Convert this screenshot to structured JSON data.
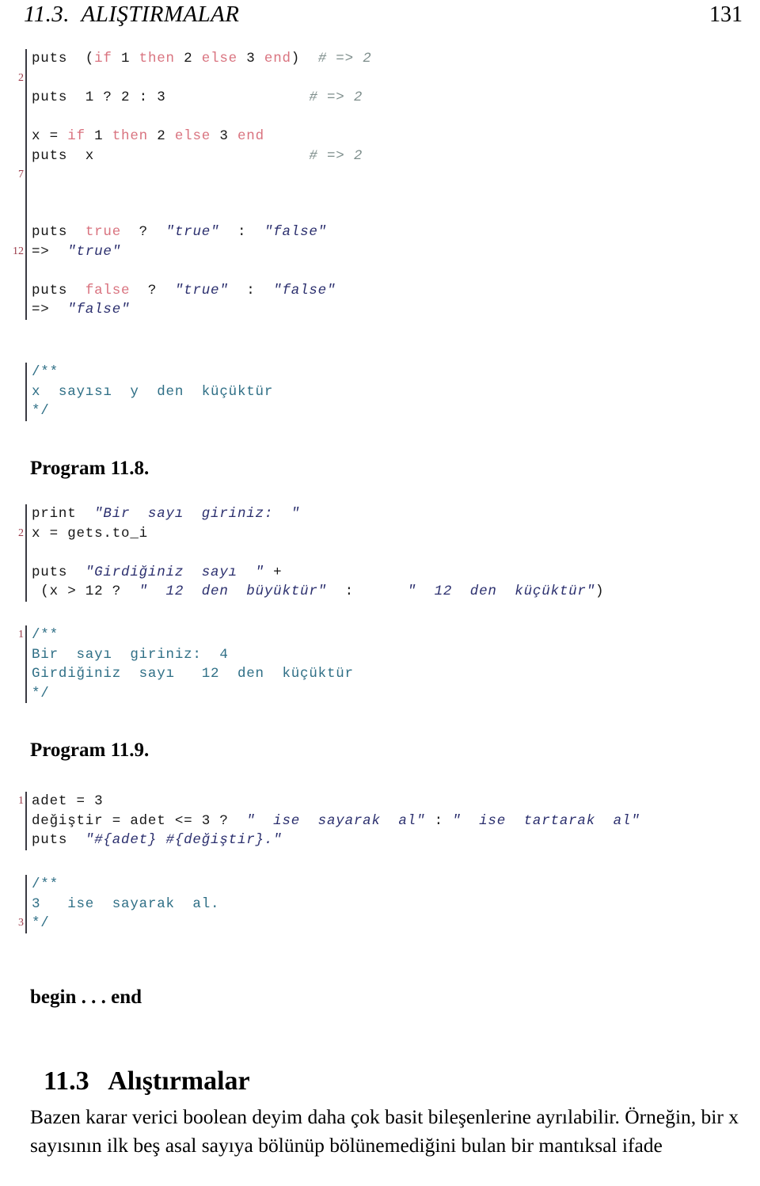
{
  "header": {
    "title": "11.3.  ALIŞTIRMALAR",
    "page_number": "131"
  },
  "listings": [
    {
      "name": "listing-ternary-if",
      "gutter": [
        {
          "num": "2",
          "line_index": 1
        },
        {
          "num": "7",
          "line_index": 6
        }
      ],
      "lines": [
        {
          "segments": [
            {
              "cls": "t-plain",
              "text": "puts  ("
            },
            {
              "cls": "t-kw",
              "text": "if"
            },
            {
              "cls": "t-plain",
              "text": " 1 "
            },
            {
              "cls": "t-kw",
              "text": "then"
            },
            {
              "cls": "t-plain",
              "text": " 2 "
            },
            {
              "cls": "t-kw",
              "text": "else"
            },
            {
              "cls": "t-plain",
              "text": " 3 "
            },
            {
              "cls": "t-kw",
              "text": "end"
            },
            {
              "cls": "t-plain",
              "text": ")  "
            },
            {
              "cls": "t-cmt",
              "text": "# => 2"
            }
          ]
        },
        {
          "segments": []
        },
        {
          "segments": [
            {
              "cls": "t-plain",
              "text": "puts  1 ? 2 : 3                "
            },
            {
              "cls": "t-cmt",
              "text": "# => 2"
            }
          ]
        },
        {
          "segments": []
        },
        {
          "segments": [
            {
              "cls": "t-plain",
              "text": "x = "
            },
            {
              "cls": "t-kw",
              "text": "if"
            },
            {
              "cls": "t-plain",
              "text": " 1 "
            },
            {
              "cls": "t-kw",
              "text": "then"
            },
            {
              "cls": "t-plain",
              "text": " 2 "
            },
            {
              "cls": "t-kw",
              "text": "else"
            },
            {
              "cls": "t-plain",
              "text": " 3 "
            },
            {
              "cls": "t-kw",
              "text": "end"
            }
          ]
        },
        {
          "segments": [
            {
              "cls": "t-plain",
              "text": "puts  x                        "
            },
            {
              "cls": "t-cmt",
              "text": "# => 2"
            }
          ]
        },
        {
          "segments": []
        },
        {
          "segments": []
        },
        {
          "segments": []
        }
      ]
    },
    {
      "name": "listing-true-false",
      "gutter": [
        {
          "num": "12",
          "line_index": 1
        }
      ],
      "lines": [
        {
          "segments": [
            {
              "cls": "t-plain",
              "text": "puts  "
            },
            {
              "cls": "t-kw",
              "text": "true"
            },
            {
              "cls": "t-plain",
              "text": "  ?  "
            },
            {
              "cls": "t-str",
              "text": "\"true\""
            },
            {
              "cls": "t-plain",
              "text": "  :  "
            },
            {
              "cls": "t-str",
              "text": "\"false\""
            }
          ]
        },
        {
          "segments": [
            {
              "cls": "t-plain",
              "text": "=>  "
            },
            {
              "cls": "t-str",
              "text": "\"true\""
            }
          ]
        },
        {
          "segments": []
        },
        {
          "segments": [
            {
              "cls": "t-plain",
              "text": "puts  "
            },
            {
              "cls": "t-kw",
              "text": "false"
            },
            {
              "cls": "t-plain",
              "text": "  ?  "
            },
            {
              "cls": "t-str",
              "text": "\"true\""
            },
            {
              "cls": "t-plain",
              "text": "  :  "
            },
            {
              "cls": "t-str",
              "text": "\"false\""
            }
          ]
        },
        {
          "segments": [
            {
              "cls": "t-plain",
              "text": "=>  "
            },
            {
              "cls": "t-str",
              "text": "\"false\""
            }
          ]
        }
      ]
    },
    {
      "name": "listing-doc-x-kucuktur",
      "gutter": [],
      "lines": [
        {
          "segments": [
            {
              "cls": "t-doc",
              "text": "/**"
            }
          ]
        },
        {
          "segments": [
            {
              "cls": "t-doc",
              "text": "x  sayısı  y  den  küçüktür"
            }
          ]
        },
        {
          "segments": [
            {
              "cls": "t-doc",
              "text": "*/"
            }
          ]
        }
      ]
    },
    {
      "name": "listing-program-11-8-code",
      "gutter": [
        {
          "num": "2",
          "line_index": 1
        }
      ],
      "lines": [
        {
          "segments": [
            {
              "cls": "t-plain",
              "text": "print  "
            },
            {
              "cls": "t-str",
              "text": "\"Bir  sayı  giriniz:  \""
            }
          ]
        },
        {
          "segments": [
            {
              "cls": "t-plain",
              "text": "x = gets.to_i"
            }
          ]
        },
        {
          "segments": []
        },
        {
          "segments": [
            {
              "cls": "t-plain",
              "text": "puts  "
            },
            {
              "cls": "t-str",
              "text": "\"Girdiğiniz  sayı  \""
            },
            {
              "cls": "t-plain",
              "text": " +"
            }
          ]
        },
        {
          "segments": [
            {
              "cls": "t-plain",
              "text": " (x > 12 ?  "
            },
            {
              "cls": "t-str",
              "text": "\"  12  den  büyüktür\""
            },
            {
              "cls": "t-plain",
              "text": "  :      "
            },
            {
              "cls": "t-str",
              "text": "\"  12  den  küçüktür\""
            },
            {
              "cls": "t-plain",
              "text": ")"
            }
          ]
        }
      ]
    },
    {
      "name": "listing-program-11-8-output",
      "gutter": [
        {
          "num": "1",
          "line_index": 0
        }
      ],
      "lines": [
        {
          "segments": [
            {
              "cls": "t-doc",
              "text": "/**"
            }
          ]
        },
        {
          "segments": [
            {
              "cls": "t-doc",
              "text": "Bir  sayı  giriniz:  4"
            }
          ]
        },
        {
          "segments": [
            {
              "cls": "t-doc",
              "text": "Girdiğiniz  sayı   12  den  küçüktür"
            }
          ]
        },
        {
          "segments": [
            {
              "cls": "t-doc",
              "text": "*/"
            }
          ]
        }
      ]
    },
    {
      "name": "listing-program-11-9-code",
      "gutter": [
        {
          "num": "1",
          "line_index": 0
        }
      ],
      "lines": [
        {
          "segments": [
            {
              "cls": "t-plain",
              "text": "adet = 3"
            }
          ]
        },
        {
          "segments": [
            {
              "cls": "t-plain",
              "text": "değiştir = adet <= 3 ?  "
            },
            {
              "cls": "t-str",
              "text": "\"  ise  sayarak  al\""
            },
            {
              "cls": "t-plain",
              "text": " : "
            },
            {
              "cls": "t-str",
              "text": "\"  ise  tartarak  al\""
            }
          ]
        },
        {
          "segments": [
            {
              "cls": "t-plain",
              "text": "puts  "
            },
            {
              "cls": "t-str",
              "text": "\"#{adet} #{değiştir}.\""
            }
          ]
        }
      ]
    },
    {
      "name": "listing-program-11-9-output",
      "gutter": [
        {
          "num": "3",
          "line_index": 2
        }
      ],
      "lines": [
        {
          "segments": [
            {
              "cls": "t-doc",
              "text": "/**"
            }
          ]
        },
        {
          "segments": [
            {
              "cls": "t-doc",
              "text": "3   ise  sayarak  al."
            }
          ]
        },
        {
          "segments": [
            {
              "cls": "t-doc",
              "text": "*/"
            }
          ]
        }
      ]
    }
  ],
  "captions": {
    "program_11_8": "Program 11.8.",
    "program_11_9": "Program 11.9."
  },
  "begin_end": "begin . . . end",
  "section": {
    "number": "11.3",
    "title": "Alıştırmalar"
  },
  "paragraph": "Bazen karar verici boolean deyim daha çok basit bileşenlerine ayrılabilir. Örneğin, bir x sayısının ilk beş asal sayıya bölünüp bölünemediğini bulan bir mantıksal ifade"
}
